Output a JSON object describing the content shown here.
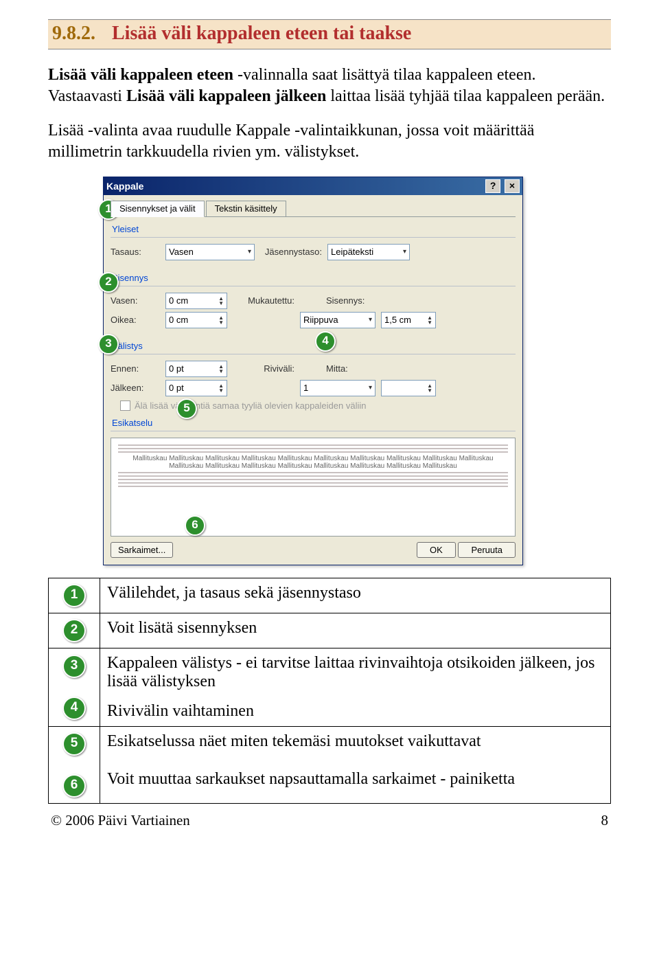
{
  "heading": {
    "number": "9.8.2.",
    "title": "Lisää väli kappaleen eteen tai taakse"
  },
  "paras": {
    "p1a": "Lisää väli kappaleen eteen",
    "p1b": " -valinnalla saat lisättyä tilaa kappaleen eteen. Vastaavasti ",
    "p1c": "Lisää väli kappaleen jälkeen",
    "p1d": " laittaa lisää tyhjää tilaa kappaleen perään.",
    "p2": "Lisää -valinta avaa ruudulle Kappale -valintaikkunan, jossa voit määrittää millimetrin tarkkuudella rivien ym. välistykset."
  },
  "dialog": {
    "title": "Kappale",
    "tabs": {
      "t1": "Sisennykset ja välit",
      "t2": "Tekstin käsittely"
    },
    "general": {
      "group": "Yleiset",
      "align_label": "Tasaus:",
      "align_value": "Vasen",
      "outline_label": "Jäsennystaso:",
      "outline_value": "Leipäteksti"
    },
    "indent": {
      "group": "Sisennys",
      "left_label": "Vasen:",
      "left_value": "0 cm",
      "right_label": "Oikea:",
      "right_value": "0 cm",
      "custom_label": "Mukautettu:",
      "special_value": "Riippuva",
      "by_label": "Sisennys:",
      "by_value": "1,5 cm"
    },
    "spacing": {
      "group": "Välistys",
      "before_label": "Ennen:",
      "before_value": "0 pt",
      "after_label": "Jälkeen:",
      "after_value": "0 pt",
      "line_label": "Riviväli:",
      "line_value": "1",
      "at_label": "Mitta:",
      "checkbox": "Älä lisää välilyöntiä samaa tyyliä olevien kappaleiden väliin"
    },
    "preview": {
      "group": "Esikatselu",
      "sample": "Mallituskau Mallituskau Mallituskau Mallituskau Mallituskau Mallituskau Mallituskau Mallituskau Mallituskau Mallituskau Mallituskau Mallituskau Mallituskau Mallituskau Mallituskau Mallituskau Mallituskau Mallituskau"
    },
    "buttons": {
      "tabs": "Sarkaimet...",
      "ok": "OK",
      "cancel": "Peruuta"
    }
  },
  "callouts": {
    "c1": "1",
    "c2": "2",
    "c3": "3",
    "c4": "4",
    "c5": "5",
    "c6": "6"
  },
  "legend": {
    "r1": "Välilehdet, ja tasaus sekä jäsennystaso",
    "r2": "Voit lisätä sisennyksen",
    "r3": "Kappaleen välistys - ei tarvitse laittaa rivinvaihtoja otsikoiden jälkeen, jos lisää välistyksen",
    "r4": "Rivivälin vaihtaminen",
    "r5": "Esikatselussa näet miten tekemäsi muutokset vaikuttavat",
    "r6": "Voit muuttaa sarkaukset napsauttamalla sarkaimet - painiketta"
  },
  "footer": {
    "left": "© 2006 Päivi Vartiainen",
    "right": "8"
  }
}
